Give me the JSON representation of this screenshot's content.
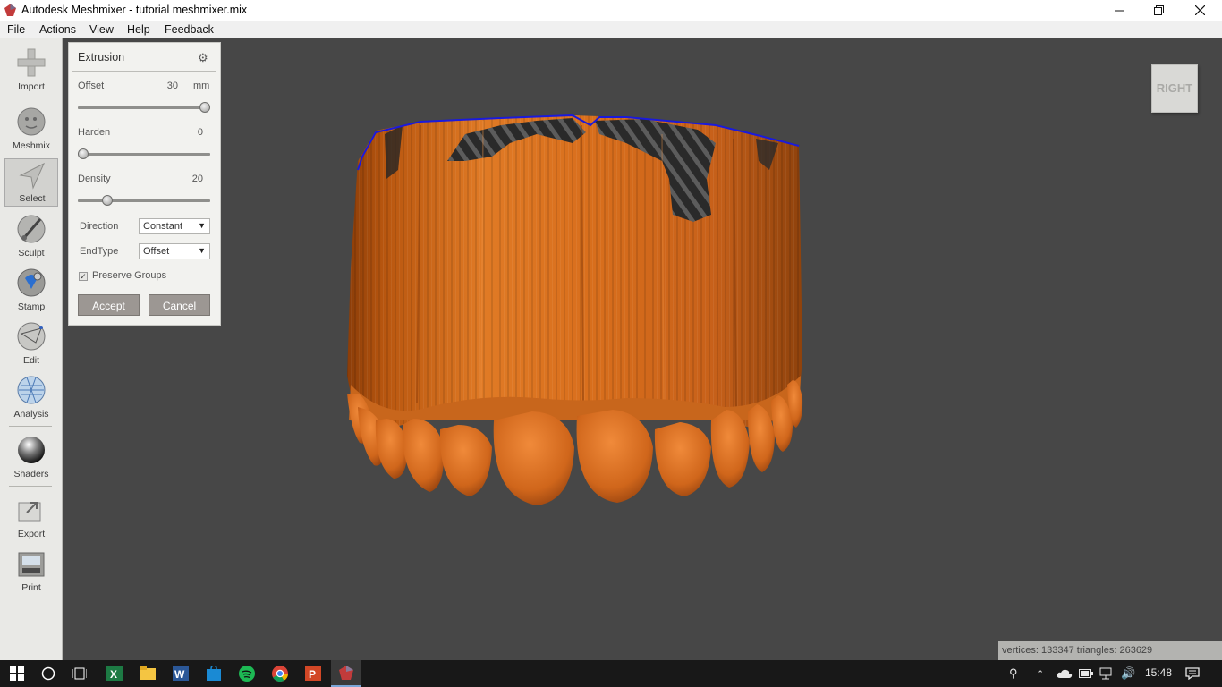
{
  "window": {
    "title": "Autodesk Meshmixer - tutorial meshmixer.mix",
    "app_icon": "meshmixer-icon",
    "buttons": [
      "minimize-icon",
      "restore-icon",
      "close-icon"
    ]
  },
  "menu": [
    "File",
    "Actions",
    "View",
    "Help",
    "Feedback"
  ],
  "toolbar": {
    "tools": [
      {
        "label": "Import",
        "icon": "plus-icon"
      },
      {
        "label": "Meshmix",
        "icon": "meshmix-face-icon"
      },
      {
        "label": "Select",
        "icon": "cursor-arrow-icon",
        "active": true
      },
      {
        "label": "Sculpt",
        "icon": "brush-icon"
      },
      {
        "label": "Stamp",
        "icon": "stamp-icon"
      },
      {
        "label": "Edit",
        "icon": "edit-sphere-icon"
      },
      {
        "label": "Analysis",
        "icon": "analysis-sphere-icon"
      },
      {
        "label": "Shaders",
        "icon": "shader-sphere-icon"
      },
      {
        "label": "Export",
        "icon": "export-icon"
      },
      {
        "label": "Print",
        "icon": "printer-icon"
      }
    ]
  },
  "panel": {
    "title": "Extrusion",
    "settings_icon": "gear-icon",
    "offset": {
      "label": "Offset",
      "value": "30",
      "unit": "mm",
      "fraction": 1.0
    },
    "harden": {
      "label": "Harden",
      "value": "0",
      "fraction": 0.0
    },
    "density": {
      "label": "Density",
      "value": "20",
      "fraction": 0.2
    },
    "direction": {
      "label": "Direction",
      "selected": "Constant"
    },
    "endtype": {
      "label": "EndType",
      "selected": "Offset"
    },
    "preserve_groups": {
      "label": "Preserve Groups",
      "checked": true
    },
    "accept": "Accept",
    "cancel": "Cancel"
  },
  "viewcube": {
    "face": "RIGHT"
  },
  "status": {
    "text": "vertices: 133347 triangles: 263629"
  },
  "colors": {
    "viewport_bg": "#474747",
    "mesh_orange": "#d2691e",
    "mesh_shadow": "#8a3c08",
    "boundary_blue": "#1a1adc",
    "button_bg": "#9c9793"
  },
  "taskbar": {
    "apps": [
      "windows-start-icon",
      "cortana-search-icon",
      "task-view-icon",
      "excel-icon",
      "file-explorer-icon",
      "word-icon",
      "store-icon",
      "spotify-icon",
      "chrome-icon",
      "powerpoint-icon",
      "meshmixer-taskbar-icon"
    ],
    "tray_icons": [
      "people-icon",
      "chevron-up-icon",
      "onedrive-cloud-icon",
      "battery-icon",
      "network-icon",
      "volume-icon"
    ],
    "time": "15:48",
    "action_center_icon": "action-center-icon"
  }
}
